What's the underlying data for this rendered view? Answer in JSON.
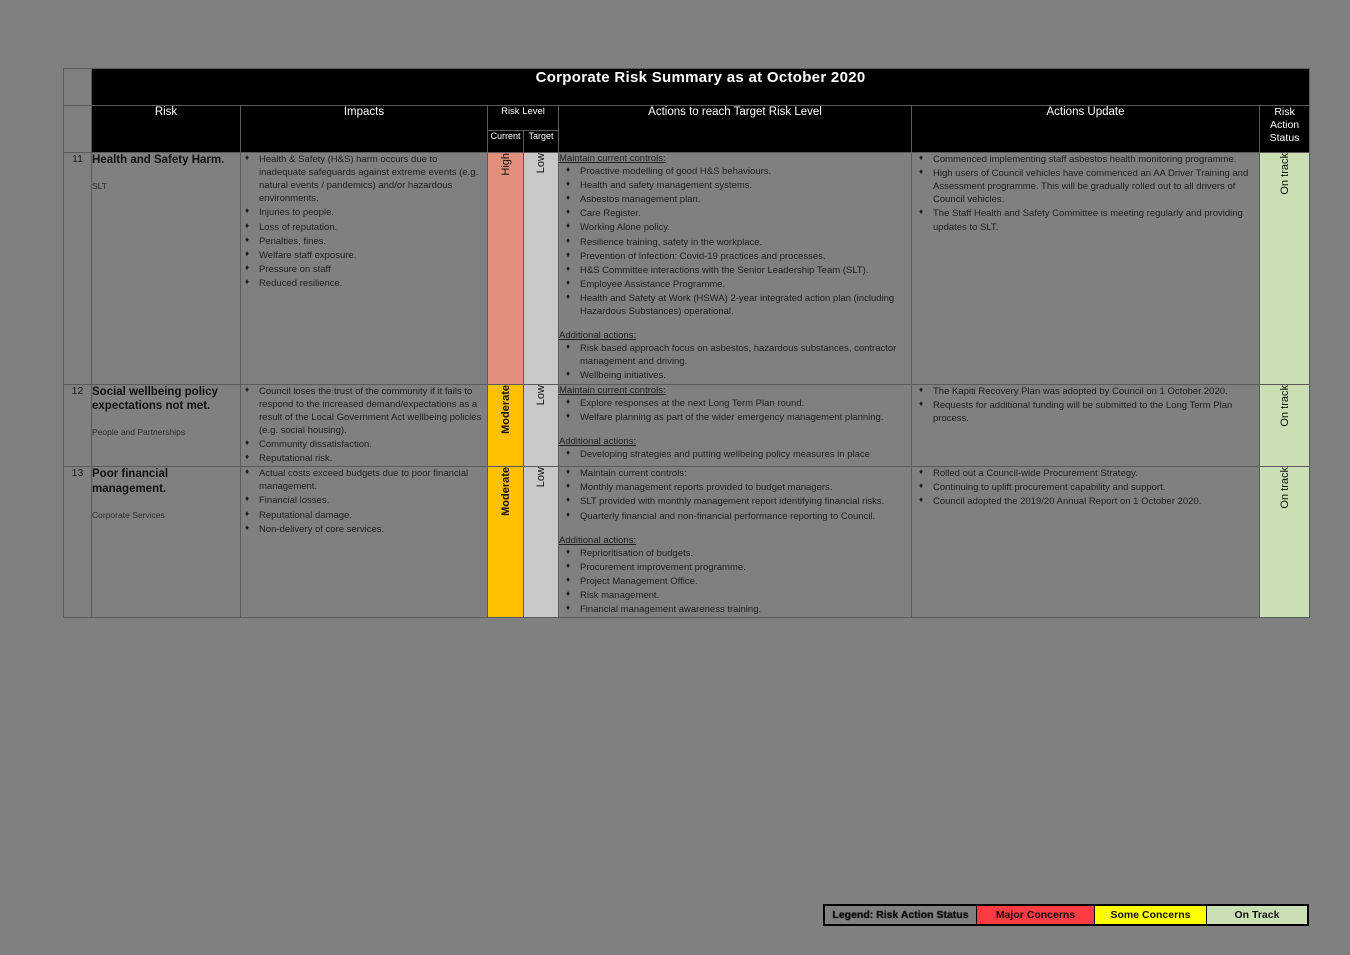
{
  "header": {
    "title": "Corporate Risk Summary as at October 2020",
    "columns": {
      "risk": "Risk",
      "impacts": "Impacts",
      "risk_level": "Risk Level",
      "current": "Current",
      "target": "Target",
      "actions": "Actions to reach Target Risk Level",
      "update": "Actions Update",
      "status_line1": "Risk",
      "status_line2": "Action",
      "status_line3": "Status"
    }
  },
  "sections": {
    "maintain": "Maintain current controls:",
    "additional": "Additional actions:"
  },
  "rows": [
    {
      "number": "11",
      "risk_name": "Health and Safety Harm.",
      "risk_dept": "SLT",
      "impacts": [
        "Health & Safety (H&S) harm occurs due to inadequate safeguards against extreme events (e.g. natural events / pandemics) and/or hazardous environments.",
        "Injuries to people.",
        "Loss of reputation.",
        "Penalties, fines.",
        "Welfare staff exposure.",
        "Pressure on staff",
        "Reduced resilience."
      ],
      "current_level": "High",
      "target_level": "Low",
      "maintain_items": [
        "Proactive modelling of good H&S behaviours.",
        "Health and safety management systems.",
        "Asbestos management plan.",
        "Care Register.",
        "Working Alone policy.",
        "Resilience training, safety in the workplace.",
        "Prevention of Infection: Covid-19 practices and processes.",
        "H&S Committee interactions with the Senior Leadership Team (SLT).",
        "Employee Assistance Programme.",
        "Health and Safety at Work (HSWA) 2-year integrated action plan (including Hazardous Substances) operational."
      ],
      "additional_items": [
        "Risk based approach focus on asbestos, hazardous substances, contractor management and driving.",
        "Wellbeing initiatives."
      ],
      "updates": [
        "Commenced implementing staff asbestos health monitoring programme.",
        "High users of Council vehicles have commenced an AA Driver Training and Assessment programme. This will be gradually rolled out to all drivers of Council vehicles.",
        "The Staff Health and Safety Committee is meeting regularly and providing updates to SLT."
      ],
      "status": "On track"
    },
    {
      "number": "12",
      "risk_name": "Social wellbeing policy expectations not met.",
      "risk_dept": "People and Partnerships",
      "impacts": [
        "Council loses the trust of the community if it fails to respond to the increased demand/expectations as a result of the Local Government Act wellbeing policies (e.g. social housing).",
        "Community dissatisfaction.",
        "Reputational risk."
      ],
      "current_level": "Moderate",
      "target_level": "Low",
      "maintain_items": [
        "Explore responses at the next Long Term Plan round.",
        "Welfare planning as part of the wider emergency management planning."
      ],
      "additional_items": [
        "Developing strategies and putting wellbeing policy measures in place"
      ],
      "updates": [
        "The Kapiti Recovery Plan was adopted by Council on 1 October 2020.",
        "Requests for additional funding will be submitted to the Long Term Plan process."
      ],
      "status": "On track"
    },
    {
      "number": "13",
      "risk_name": "Poor financial management.",
      "risk_dept": "Corporate Services",
      "impacts": [
        "Actual costs exceed budgets due to poor financial management.",
        "Financial losses.",
        "Reputational damage.",
        "Non-delivery of core services."
      ],
      "current_level": "Moderate",
      "target_level": "Low",
      "maintain_items": [
        "Maintain current controls:",
        "Monthly management reports provided to budget managers.",
        "SLT provided with monthly management report identifying financial risks.",
        "Quarterly financial and non-financial performance reporting to Council."
      ],
      "additional_items": [
        "Reprioritisation of budgets.",
        "Procurement improvement programme.",
        "Project Management Office.",
        "Risk management.",
        "Financial management awareness training."
      ],
      "updates": [
        "Rolled out a Council-wide Procurement Strategy.",
        "Continuing to uplift procurement capability and support.",
        "Council adopted the 2019/20 Annual Report on 1 October 2020."
      ],
      "status": "On track"
    }
  ],
  "legend": {
    "label": "Legend: Risk Action Status",
    "major": "Major Concerns",
    "some": "Some Concerns",
    "ontrack": "On Track",
    "colors": {
      "major": "#FF3B44",
      "some": "#FFFF00",
      "ontrack": "#CBDFB5",
      "high": "#E1907B",
      "moderate": "#FFC000",
      "low": "#C8C8C8"
    }
  }
}
